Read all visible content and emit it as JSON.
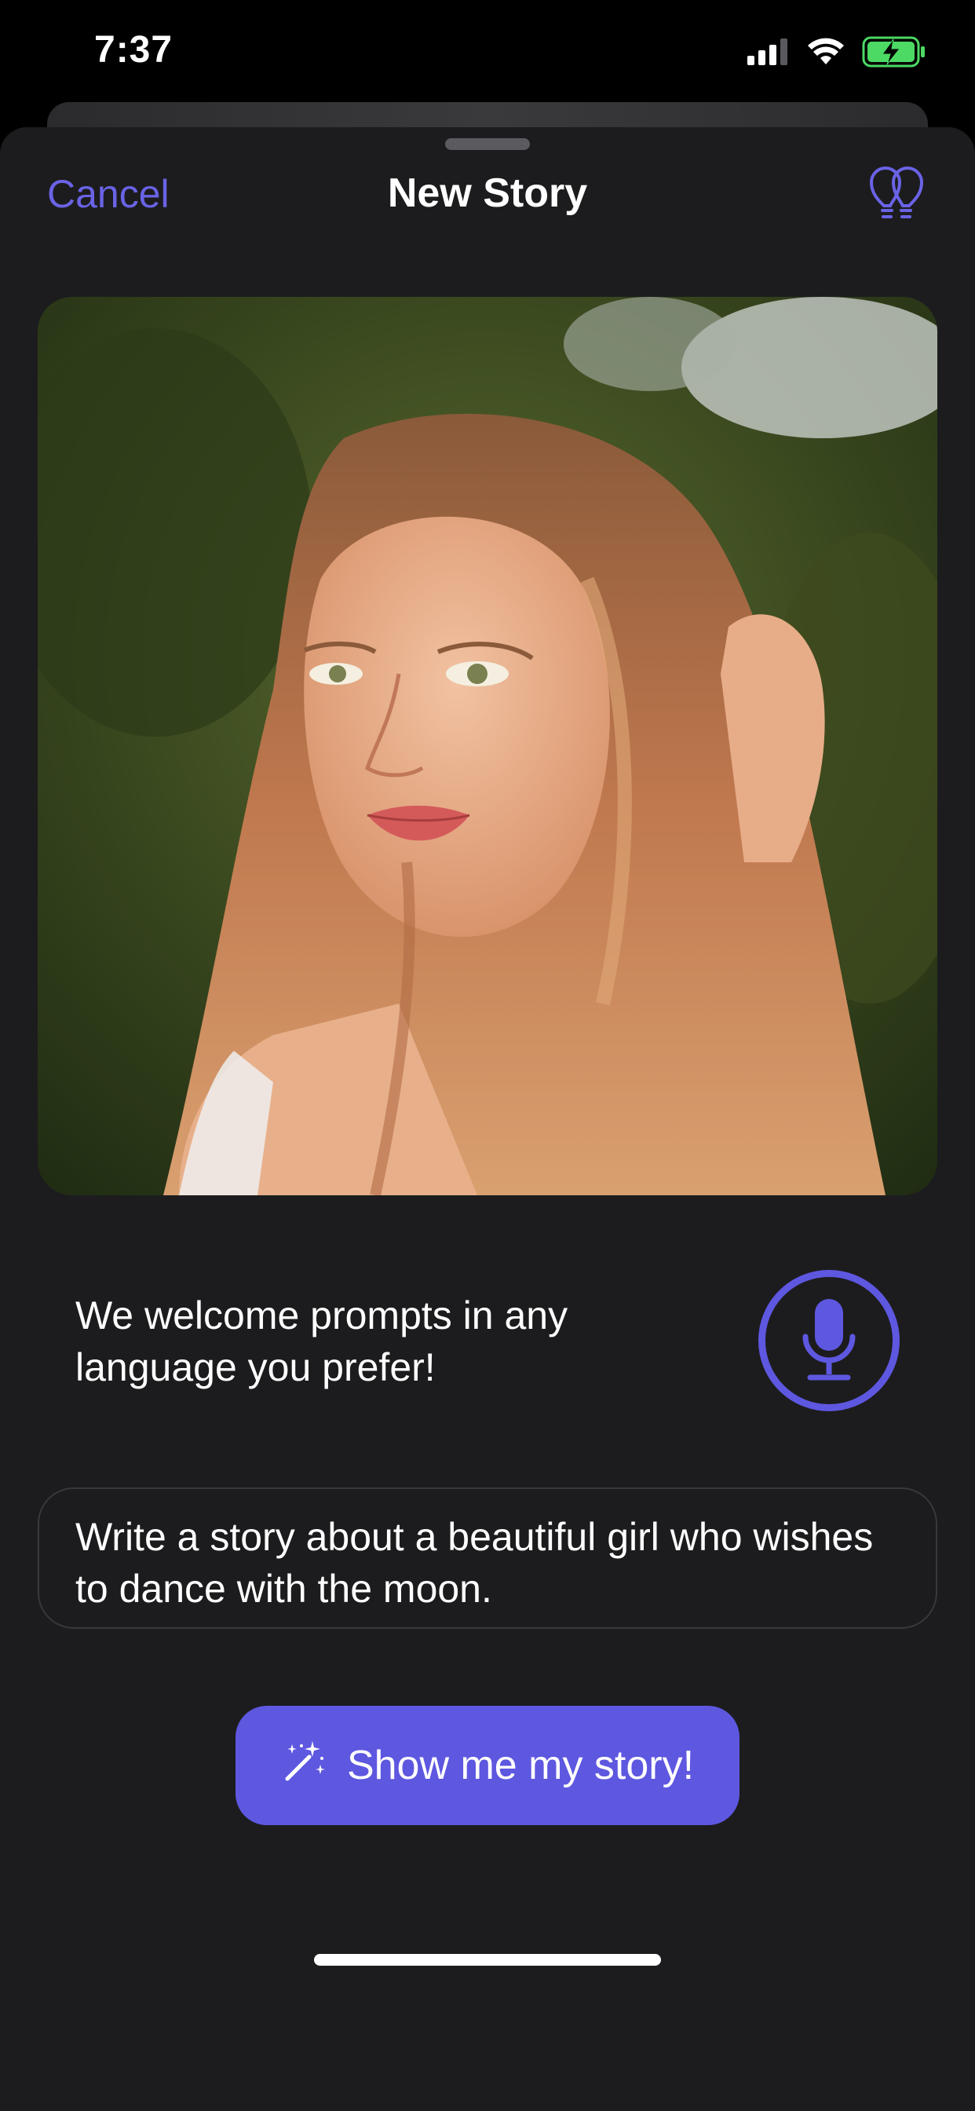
{
  "status_bar": {
    "time": "7:37",
    "icons": [
      "signal-icon",
      "wifi-icon",
      "battery-charging-icon"
    ],
    "battery_color": "#4cd964"
  },
  "nav": {
    "cancel_label": "Cancel",
    "title": "New Story",
    "right_icon": "lightbulbs-icon"
  },
  "photo": {
    "icon": "portrait-photo"
  },
  "hint": {
    "text": "We welcome prompts in any language you prefer!"
  },
  "mic": {
    "icon": "microphone-icon"
  },
  "prompt": {
    "value": "Write a story about a beautiful girl who wishes to dance with the moon."
  },
  "primary_button": {
    "label": "Show me my story!",
    "icon": "magic-wand-icon"
  },
  "colors": {
    "accent": "#5e57e0",
    "sheet_background": "#1c1c1e",
    "text": "#ffffff"
  }
}
